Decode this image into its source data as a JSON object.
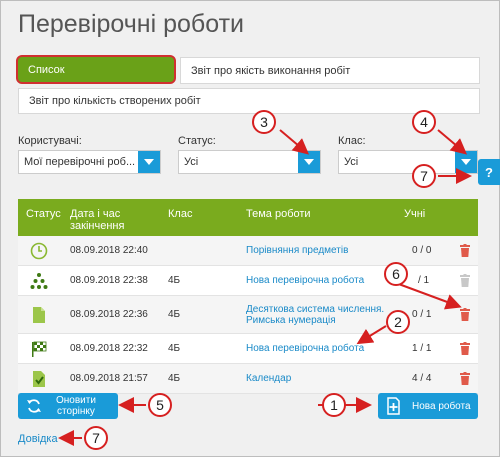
{
  "page": {
    "title": "Перевірочні роботи"
  },
  "tabs": [
    {
      "label": "Список"
    },
    {
      "label": "Звіт про якість виконання робіт"
    },
    {
      "label": "Звіт про кількість створених робіт"
    }
  ],
  "filters": {
    "users": {
      "label": "Користувачі:",
      "value": "Мої перевірочні роб..."
    },
    "status": {
      "label": "Статус:",
      "value": "Усі"
    },
    "class": {
      "label": "Клас:",
      "value": "Усі"
    }
  },
  "help_button": "?",
  "table": {
    "headers": {
      "status": "Статус",
      "datetime_line1": "Дата і час",
      "datetime_line2": "закінчення",
      "class": "Клас",
      "topic": "Тема роботи",
      "students": "Учні"
    },
    "rows": [
      {
        "status_icon": "clock-icon",
        "datetime": "08.09.2018 22:40",
        "class": "",
        "topic": "Порівняння предметів",
        "topic2": "",
        "students": "0 / 0",
        "trash_active": true
      },
      {
        "status_icon": "hierarchy-icon",
        "datetime": "08.09.2018 22:38",
        "class": "4Б",
        "topic": "Нова перевірочна робота",
        "topic2": "",
        "students": "/ 1",
        "trash_active": false
      },
      {
        "status_icon": "document-icon",
        "datetime": "08.09.2018 22:36",
        "class": "4Б",
        "topic": "Десяткова система числення.",
        "topic2": "Римська нумерація",
        "students": "0 / 1",
        "trash_active": true
      },
      {
        "status_icon": "checkered-flag-icon",
        "datetime": "08.09.2018 22:32",
        "class": "4Б",
        "topic": "Нова перевірочна робота",
        "topic2": "",
        "students": "1 / 1",
        "trash_active": true
      },
      {
        "status_icon": "document-check-icon",
        "datetime": "08.09.2018 21:57",
        "class": "4Б",
        "topic": "Календар",
        "topic2": "",
        "students": "4 / 4",
        "trash_active": true
      }
    ]
  },
  "buttons": {
    "refresh_line1": "Оновити",
    "refresh_line2": "сторінку",
    "new_work": "Нова робота"
  },
  "help_link": "Довідка",
  "annotations": [
    "1",
    "2",
    "3",
    "4",
    "5",
    "6",
    "7",
    "7"
  ],
  "colors": {
    "accent_green": "#7aab1e",
    "accent_blue": "#1a9bd8",
    "annotation_red": "#d62020",
    "link_blue": "#1a8ac8"
  }
}
